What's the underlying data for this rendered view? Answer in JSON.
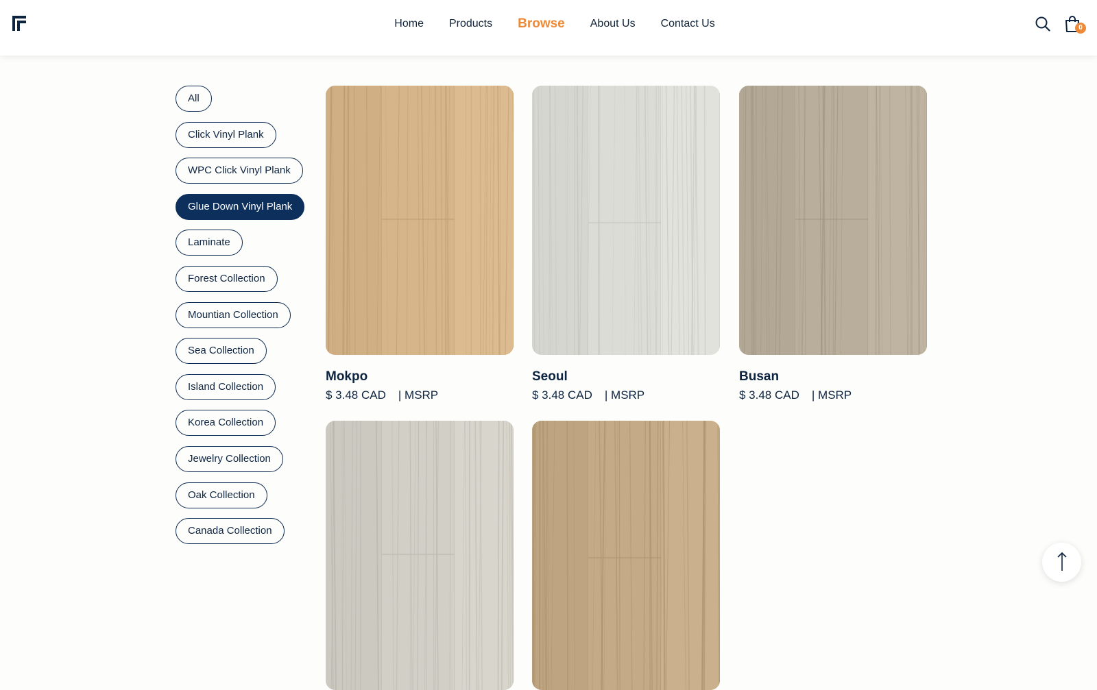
{
  "brand": {
    "logo_icon": "stylized-F-logo-icon",
    "accent_color": "#ec8a3a",
    "primary_color": "#0c2f5c"
  },
  "nav": {
    "items": [
      {
        "label": "Home",
        "active": false
      },
      {
        "label": "Products",
        "active": false
      },
      {
        "label": "Browse",
        "active": true
      },
      {
        "label": "About Us",
        "active": false
      },
      {
        "label": "Contact Us",
        "active": false
      }
    ]
  },
  "header": {
    "search_icon": "search-icon",
    "cart_icon": "shopping-bag-icon",
    "cart_count": "0"
  },
  "filters": {
    "selected": "Glue Down Vinyl Plank",
    "items": [
      "All",
      "Click Vinyl Plank",
      "WPC Click Vinyl Plank",
      "Glue Down Vinyl Plank",
      "Laminate",
      "Forest Collection",
      "Mountian Collection",
      "Sea Collection",
      "Island Collection",
      "Korea Collection",
      "Jewelry Collection",
      "Oak Collection",
      "Canada Collection"
    ]
  },
  "products": [
    {
      "name": "Mokpo",
      "price": "$ 3.48 CAD",
      "suffix": "| MSRP",
      "color": "#d6b58a"
    },
    {
      "name": "Seoul",
      "price": "$ 3.48 CAD",
      "suffix": "| MSRP",
      "color": "#dcdcd6"
    },
    {
      "name": "Busan",
      "price": "$ 3.48 CAD",
      "suffix": "| MSRP",
      "color": "#b8ae9b"
    },
    {
      "name": "",
      "price": "",
      "suffix": "",
      "color": "#d2cfc7"
    },
    {
      "name": "",
      "price": "",
      "suffix": "",
      "color": "#c4aa86"
    }
  ],
  "scroll_top": {
    "icon": "arrow-up-icon"
  }
}
